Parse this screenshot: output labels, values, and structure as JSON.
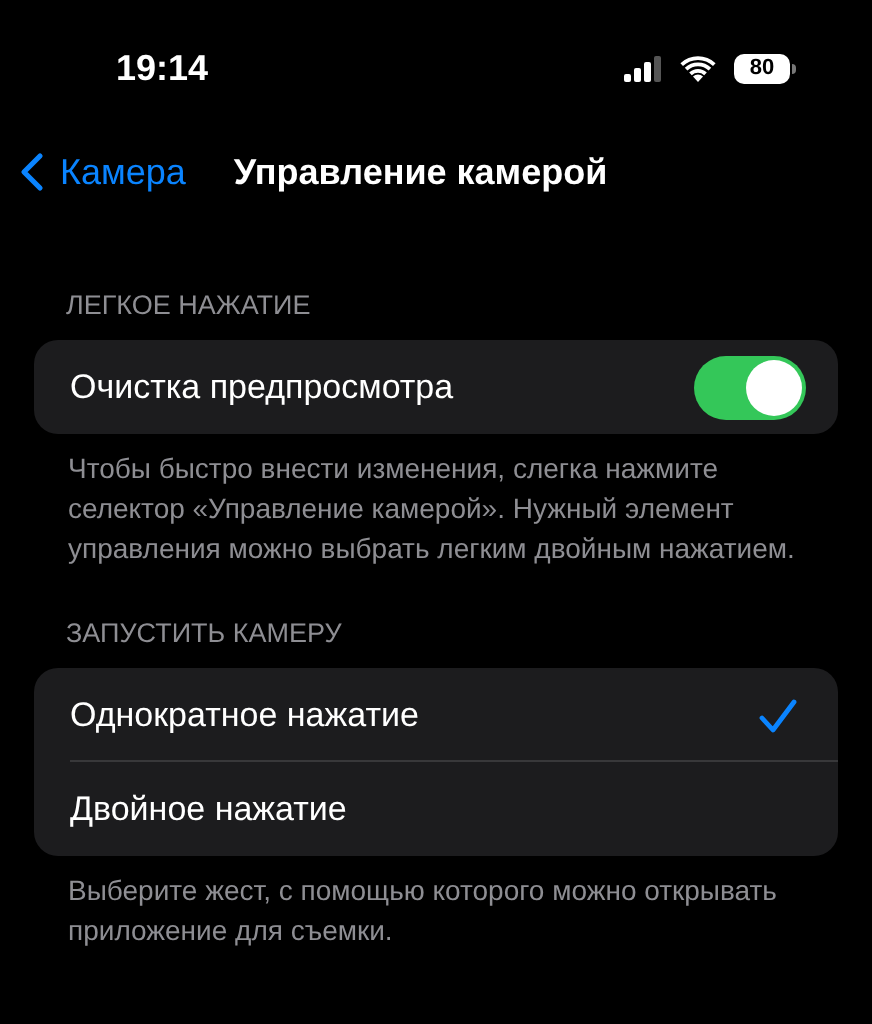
{
  "status_bar": {
    "time": "19:14",
    "battery": "80"
  },
  "nav": {
    "back": "Камера",
    "title": "Управление камерой"
  },
  "sections": [
    {
      "header": "ЛЕГКОЕ НАЖАТИЕ",
      "rows": [
        {
          "kind": "toggle",
          "label": "Очистка предпросмотра",
          "on": true
        }
      ],
      "footer": "Чтобы быстро внести изменения, слегка нажмите селектор «Управление камерой». Нужный элемент управления можно выбрать легким двойным нажатием."
    },
    {
      "header": "ЗАПУСТИТЬ КАМЕРУ",
      "rows": [
        {
          "kind": "choice",
          "label": "Однократное нажатие",
          "selected": true
        },
        {
          "kind": "choice",
          "label": "Двойное нажатие",
          "selected": false
        }
      ],
      "footer": "Выберите жест, с помощью которого можно открывать приложение для съемки."
    }
  ]
}
